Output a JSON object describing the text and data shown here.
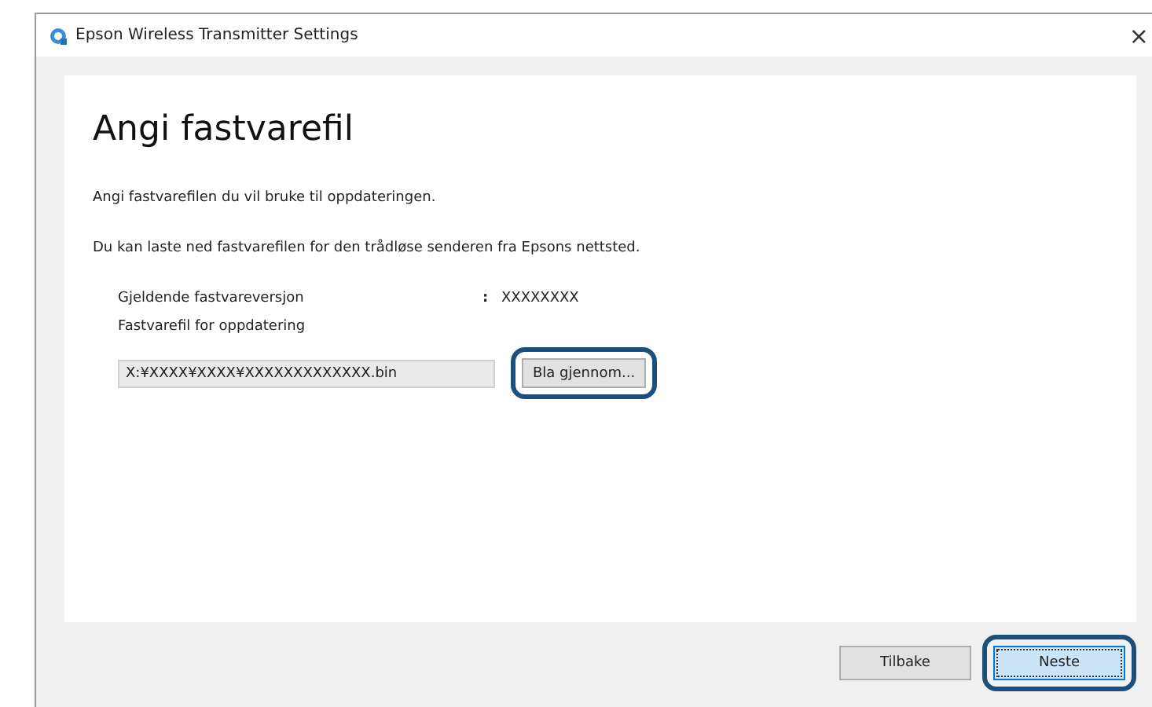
{
  "window": {
    "title": "Epson Wireless Transmitter Settings",
    "close": "×"
  },
  "heading": "Angi fastvarefil",
  "instructions": [
    "Angi fastvarefilen du vil bruke til oppdateringen.",
    "Du kan laste ned fastvarefilen for den trådløse senderen fra Epsons nettsted."
  ],
  "current_version": {
    "label": "Gjeldende fastvareversjon",
    "separator": ":",
    "value": "XXXXXXXX"
  },
  "update_file": {
    "label": "Fastvarefil for oppdatering",
    "value": "X:¥XXXX¥XXXX¥XXXXXXXXXXXXX.bin",
    "browse_button": {
      "label": "Bla gjennom...",
      "highlighted": true
    }
  },
  "buttons": [
    {
      "label": "Tilbake",
      "focused": false,
      "highlighted": false
    },
    {
      "label": "Neste",
      "focused": true,
      "highlighted": true
    }
  ]
}
